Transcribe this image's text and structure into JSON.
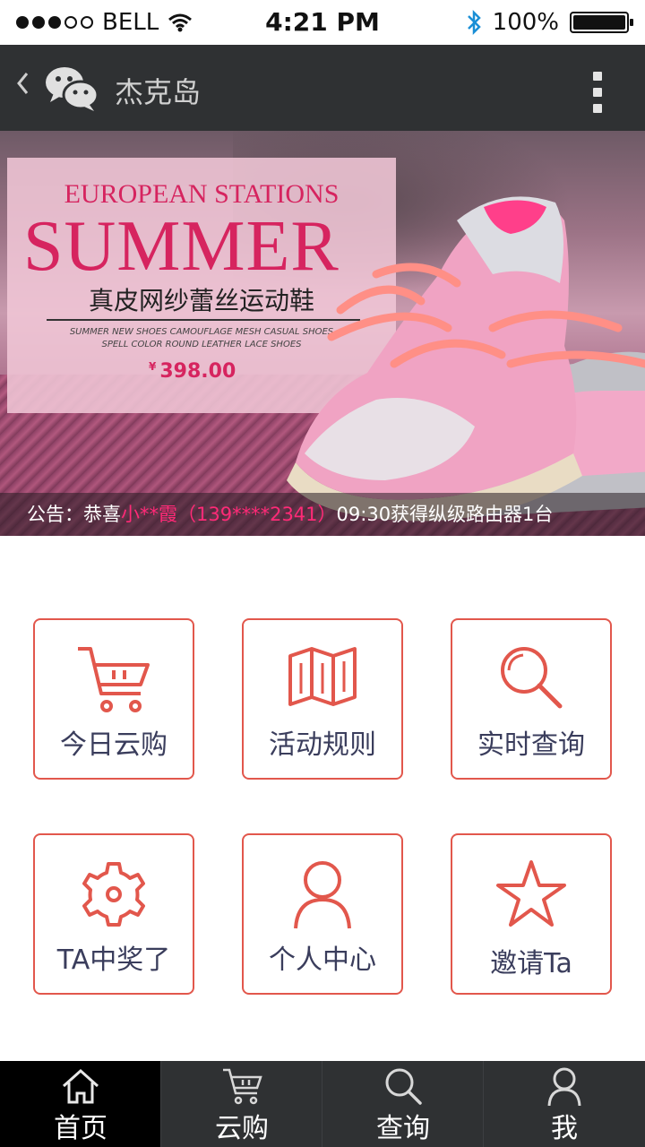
{
  "status_bar": {
    "carrier": "BELL",
    "time": "4:21 PM",
    "battery": "100%"
  },
  "nav": {
    "back_icon": "chevron-left-icon",
    "title": "杰克岛",
    "more_icon": "more-vertical-icon"
  },
  "banner": {
    "top_line": "EUROPEAN STATIONS",
    "headline": "SUMMER",
    "subtitle": "真皮网纱蕾丝运动鞋",
    "desc_line1": "SUMMER NEW SHOES CAMOUFLAGE MESH CASUAL SHOES",
    "desc_line2": "SPELL COLOR ROUND LEATHER LACE SHOES",
    "currency": "¥",
    "price": "398.00"
  },
  "notice": {
    "prefix": "公告：恭喜",
    "winner": "小**霞（139****2341）",
    "suffix": "09:30获得纵级路由器1台"
  },
  "menu": [
    {
      "label": "今日云购",
      "icon": "cart-icon"
    },
    {
      "label": "活动规则",
      "icon": "book-icon"
    },
    {
      "label": "实时查询",
      "icon": "search-icon"
    },
    {
      "label": "TA中奖了",
      "icon": "gear-icon"
    },
    {
      "label": "个人中心",
      "icon": "user-icon"
    },
    {
      "label": "邀请Ta",
      "icon": "star-icon"
    }
  ],
  "tabs": [
    {
      "label": "首页",
      "icon": "home-icon",
      "active": true
    },
    {
      "label": "云购",
      "icon": "cart-icon"
    },
    {
      "label": "查询",
      "icon": "search-icon"
    },
    {
      "label": "我",
      "icon": "user-icon"
    }
  ],
  "colors": {
    "accent": "#e2574c",
    "label": "#3a3d5c",
    "nav_bg": "#2f3133",
    "promo_pink": "#d6245f",
    "notice_highlight": "#ff2a77"
  }
}
